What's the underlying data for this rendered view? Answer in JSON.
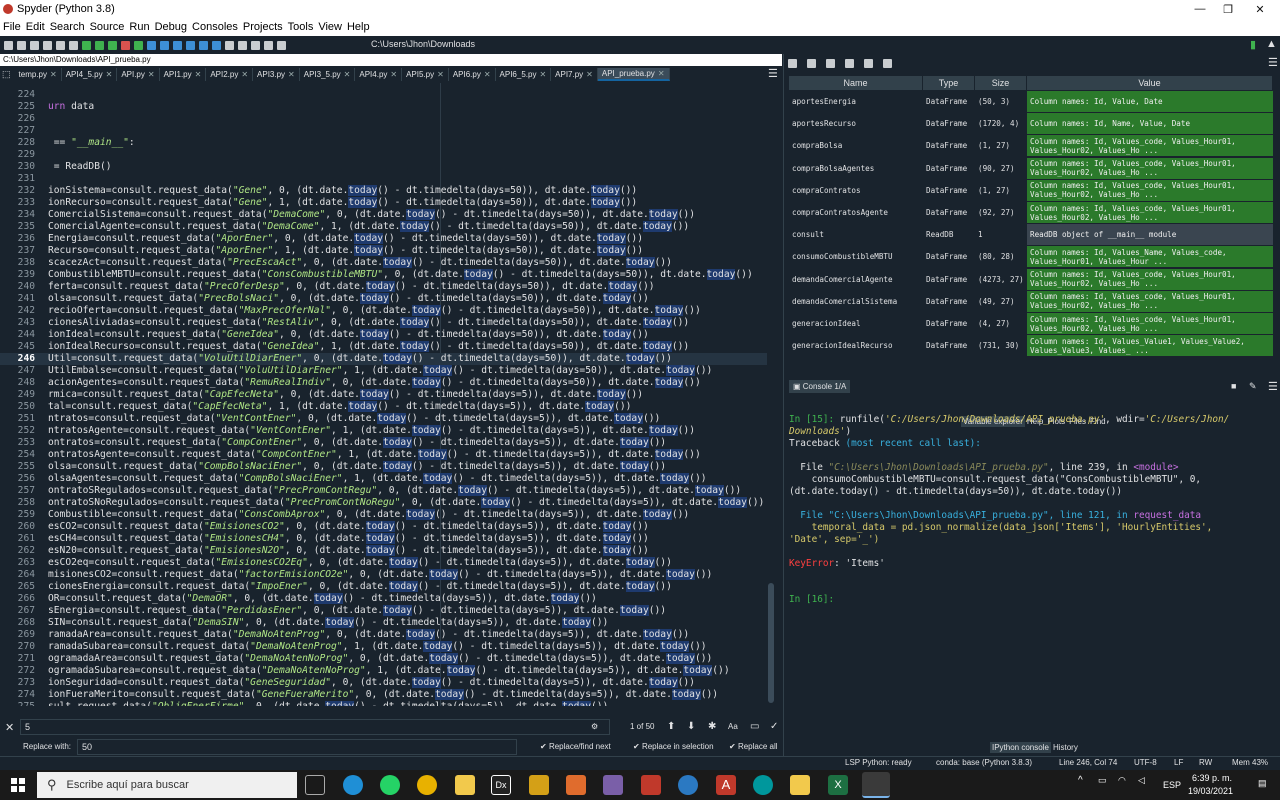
{
  "window": {
    "title": "Spyder (Python 3.8)",
    "minimize": "—",
    "restore": "❐",
    "close": "✕"
  },
  "menu": [
    "File",
    "Edit",
    "Search",
    "Source",
    "Run",
    "Debug",
    "Consoles",
    "Projects",
    "Tools",
    "View",
    "Help"
  ],
  "toolbar": {
    "path": "C:\\Users\\Jhon\\Downloads"
  },
  "editor": {
    "filepath": "C:\\Users\\Jhon\\Downloads\\API_prueba.py",
    "tabs": [
      "temp.py",
      "API4_5.py",
      "API.py",
      "API1.py",
      "API2.py",
      "API3.py",
      "API3_5.py",
      "API4.py",
      "API5.py",
      "API6.py",
      "API6_5.py",
      "API7.py",
      "API_prueba.py"
    ],
    "active_tab": "API_prueba.py",
    "current_line": 246,
    "lines": [
      {
        "n": "224",
        "t": ""
      },
      {
        "n": "225",
        "t": "urn data"
      },
      {
        "n": "226",
        "t": ""
      },
      {
        "n": "227",
        "t": ""
      },
      {
        "n": "228",
        "t": " == \"__main__\":"
      },
      {
        "n": "229",
        "t": ""
      },
      {
        "n": "230",
        "t": " = ReadDB()"
      },
      {
        "n": "231",
        "t": ""
      },
      {
        "n": "232",
        "t": "ionSistema=consult.request_data(\"Gene\", 0, (dt.date.today() - dt.timedelta(days=50)), dt.date.today())"
      },
      {
        "n": "233",
        "t": "ionRecurso=consult.request_data(\"Gene\", 1, (dt.date.today() - dt.timedelta(days=50)), dt.date.today())"
      },
      {
        "n": "234",
        "t": "ComercialSistema=consult.request_data(\"DemaCome\", 0, (dt.date.today() - dt.timedelta(days=50)), dt.date.today())"
      },
      {
        "n": "235",
        "t": "ComercialAgente=consult.request_data(\"DemaCome\", 1, (dt.date.today() - dt.timedelta(days=50)), dt.date.today())"
      },
      {
        "n": "236",
        "t": "Energia=consult.request_data(\"AporEner\", 0, (dt.date.today() - dt.timedelta(days=50)), dt.date.today())"
      },
      {
        "n": "237",
        "t": "Recurso=consult.request_data(\"AporEner\", 1, (dt.date.today() - dt.timedelta(days=50)), dt.date.today())"
      },
      {
        "n": "238",
        "t": "scacezAct=consult.request_data(\"PrecEscaAct\", 0, (dt.date.today() - dt.timedelta(days=50)), dt.date.today())"
      },
      {
        "n": "239",
        "t": "CombustibleMBTU=consult.request_data(\"ConsCombustibleMBTU\", 0, (dt.date.today() - dt.timedelta(days=50)), dt.date.today())"
      },
      {
        "n": "240",
        "t": "ferta=consult.request_data(\"PrecOferDesp\", 0, (dt.date.today() - dt.timedelta(days=50)), dt.date.today())"
      },
      {
        "n": "241",
        "t": "olsa=consult.request_data(\"PrecBolsNaci\", 0, (dt.date.today() - dt.timedelta(days=50)), dt.date.today())"
      },
      {
        "n": "242",
        "t": "recioOferta=consult.request_data(\"MaxPrecOferNal\", 0, (dt.date.today() - dt.timedelta(days=50)), dt.date.today())"
      },
      {
        "n": "243",
        "t": "cionesAliviadas=consult.request_data(\"RestAliv\", 0, (dt.date.today() - dt.timedelta(days=50)), dt.date.today())"
      },
      {
        "n": "244",
        "t": "ionIdeal=consult.request_data(\"GeneIdea\", 0, (dt.date.today() - dt.timedelta(days=50)), dt.date.today())"
      },
      {
        "n": "245",
        "t": "ionIdealRecurso=consult.request_data(\"GeneIdea\", 1, (dt.date.today() - dt.timedelta(days=50)), dt.date.today())"
      },
      {
        "n": "246",
        "t": "Util=consult.request_data(\"VoluUtilDiarEner\", 0, (dt.date.today() - dt.timedelta(days=50)), dt.date.today())"
      },
      {
        "n": "247",
        "t": "UtilEmbalse=consult.request_data(\"VoluUtilDiarEner\", 1, (dt.date.today() - dt.timedelta(days=50)), dt.date.today())"
      },
      {
        "n": "248",
        "t": "acionAgentes=consult.request_data(\"RemuRealIndiv\", 0, (dt.date.today() - dt.timedelta(days=50)), dt.date.today())"
      },
      {
        "n": "249",
        "t": "rmica=consult.request_data(\"CapEfecNeta\", 0, (dt.date.today() - dt.timedelta(days=5)), dt.date.today())"
      },
      {
        "n": "250",
        "t": "tal=consult.request_data(\"CapEfecNeta\", 1, (dt.date.today() - dt.timedelta(days=5)), dt.date.today())"
      },
      {
        "n": "251",
        "t": "ntratos=consult.request_data(\"VentContEner\", 0, (dt.date.today() - dt.timedelta(days=5)), dt.date.today())"
      },
      {
        "n": "252",
        "t": "ntratosAgente=consult.request_data(\"VentContEner\", 1, (dt.date.today() - dt.timedelta(days=5)), dt.date.today())"
      },
      {
        "n": "253",
        "t": "ontratos=consult.request_data(\"CompContEner\", 0, (dt.date.today() - dt.timedelta(days=5)), dt.date.today())"
      },
      {
        "n": "254",
        "t": "ontratosAgente=consult.request_data(\"CompContEner\", 1, (dt.date.today() - dt.timedelta(days=5)), dt.date.today())"
      },
      {
        "n": "255",
        "t": "olsa=consult.request_data(\"CompBolsNaciEner\", 0, (dt.date.today() - dt.timedelta(days=5)), dt.date.today())"
      },
      {
        "n": "256",
        "t": "olsaAgentes=consult.request_data(\"CompBolsNaciEner\", 1, (dt.date.today() - dt.timedelta(days=5)), dt.date.today())"
      },
      {
        "n": "257",
        "t": "ontratoSRegulados=consult.request_data(\"PrecPromContRegu\", 0, (dt.date.today() - dt.timedelta(days=5)), dt.date.today())"
      },
      {
        "n": "258",
        "t": "ontratoSNoRegulados=consult.request_data(\"PrecPromContNoRegu\", 0, (dt.date.today() - dt.timedelta(days=5)), dt.date.today())"
      },
      {
        "n": "259",
        "t": "Combustible=consult.request_data(\"ConsCombAprox\", 0, (dt.date.today() - dt.timedelta(days=5)), dt.date.today())"
      },
      {
        "n": "260",
        "t": "esCO2=consult.request_data(\"EmisionesCO2\", 0, (dt.date.today() - dt.timedelta(days=5)), dt.date.today())"
      },
      {
        "n": "261",
        "t": "esCH4=consult.request_data(\"EmisionesCH4\", 0, (dt.date.today() - dt.timedelta(days=5)), dt.date.today())"
      },
      {
        "n": "262",
        "t": "esN20=consult.request_data(\"EmisionesN2O\", 0, (dt.date.today() - dt.timedelta(days=5)), dt.date.today())"
      },
      {
        "n": "263",
        "t": "esCO2eq=consult.request_data(\"EmisionesCO2Eq\", 0, (dt.date.today() - dt.timedelta(days=5)), dt.date.today())"
      },
      {
        "n": "264",
        "t": "misionesCO2=consult.request_data(\"factorEmisionCO2e\", 0, (dt.date.today() - dt.timedelta(days=5)), dt.date.today())"
      },
      {
        "n": "265",
        "t": "cionesEnergia=consult.request_data(\"ImpoEner\", 0, (dt.date.today() - dt.timedelta(days=5)), dt.date.today())"
      },
      {
        "n": "266",
        "t": "OR=consult.request_data(\"DemaOR\", 0, (dt.date.today() - dt.timedelta(days=5)), dt.date.today())"
      },
      {
        "n": "267",
        "t": "sEnergia=consult.request_data(\"PerdidasEner\", 0, (dt.date.today() - dt.timedelta(days=5)), dt.date.today())"
      },
      {
        "n": "268",
        "t": "SIN=consult.request_data(\"DemaSIN\", 0, (dt.date.today() - dt.timedelta(days=5)), dt.date.today())"
      },
      {
        "n": "269",
        "t": "ramadaArea=consult.request_data(\"DemaNoAtenProg\", 0, (dt.date.today() - dt.timedelta(days=5)), dt.date.today())"
      },
      {
        "n": "270",
        "t": "ramadaSubarea=consult.request_data(\"DemaNoAtenProg\", 1, (dt.date.today() - dt.timedelta(days=5)), dt.date.today())"
      },
      {
        "n": "271",
        "t": "ogramadaArea=consult.request_data(\"DemaNoAtenNoProg\", 0, (dt.date.today() - dt.timedelta(days=5)), dt.date.today())"
      },
      {
        "n": "272",
        "t": "ogramadaSubarea=consult.request_data(\"DemaNoAtenNoProg\", 1, (dt.date.today() - dt.timedelta(days=5)), dt.date.today())"
      },
      {
        "n": "273",
        "t": "ionSeguridad=consult.request_data(\"GeneSeguridad\", 0, (dt.date.today() - dt.timedelta(days=5)), dt.date.today())"
      },
      {
        "n": "274",
        "t": "ionFueraMerito=consult.request_data(\"GeneFueraMerito\", 0, (dt.date.today() - dt.timedelta(days=5)), dt.date.today())"
      },
      {
        "n": "275",
        "t": "sult.request_data(\"ObligEnerFirme\", 0, (dt.date.today() - dt.timedelta(days=5)), dt.date.today())"
      }
    ]
  },
  "find": {
    "search_value": "5",
    "counter": "1 of 50",
    "replace_label": "Replace with:",
    "replace_value": "50",
    "replace_find_next": "Replace/find next",
    "replace_in_selection": "Replace in selection",
    "replace_all": "Replace all",
    "case_label": "Aa"
  },
  "variable_explorer": {
    "headers": [
      "Name",
      "Type",
      "Size",
      "Value"
    ],
    "rows": [
      {
        "name": "aportesEnergia",
        "type": "DataFrame",
        "size": "(50, 3)",
        "value": "Column names: Id, Value, Date"
      },
      {
        "name": "aportesRecurso",
        "type": "DataFrame",
        "size": "(1720, 4)",
        "value": "Column names: Id, Name, Value, Date"
      },
      {
        "name": "compraBolsa",
        "type": "DataFrame",
        "size": "(1, 27)",
        "value": "Column names: Id, Values_code, Values_Hour01,\nValues_Hour02, Values_Ho ..."
      },
      {
        "name": "compraBolsaAgentes",
        "type": "DataFrame",
        "size": "(90, 27)",
        "value": "Column names: Id, Values_code, Values_Hour01,\nValues_Hour02, Values_Ho ..."
      },
      {
        "name": "compraContratos",
        "type": "DataFrame",
        "size": "(1, 27)",
        "value": "Column names: Id, Values_code, Values_Hour01,\nValues_Hour02, Values_Ho ..."
      },
      {
        "name": "compraContratosAgente",
        "type": "DataFrame",
        "size": "(92, 27)",
        "value": "Column names: Id, Values_code, Values_Hour01,\nValues_Hour02, Values_Ho ..."
      },
      {
        "name": "consult",
        "type": "ReadDB",
        "size": "1",
        "value": "ReadDB object of __main__ module"
      },
      {
        "name": "consumoCombustibleMBTU",
        "type": "DataFrame",
        "size": "(80, 28)",
        "value": "Column names: Id, Values_Name, Values_code,\nValues_Hour01, Values_Hour ..."
      },
      {
        "name": "demandaComercialAgente",
        "type": "DataFrame",
        "size": "(4273, 27)",
        "value": "Column names: Id, Values_code, Values_Hour01,\nValues_Hour02, Values_Ho ..."
      },
      {
        "name": "demandaComercialSistema",
        "type": "DataFrame",
        "size": "(49, 27)",
        "value": "Column names: Id, Values_code, Values_Hour01,\nValues_Hour02, Values_Ho ..."
      },
      {
        "name": "generacionIdeal",
        "type": "DataFrame",
        "size": "(4, 27)",
        "value": "Column names: Id, Values_code, Values_Hour01,\nValues_Hour02, Values_Ho ..."
      },
      {
        "name": "generacionIdealRecurso",
        "type": "DataFrame",
        "size": "(731, 30)",
        "value": "Column names: Id, Values_Value1, Values_Value2,\nValues_Value3, Values_ ..."
      }
    ],
    "tabs": [
      "Variable explorer",
      "Help",
      "Plots",
      "Files",
      "Find"
    ]
  },
  "console": {
    "tab": "Console 1/A",
    "prompt15": "In [15]:",
    "runfile": " runfile(",
    "runfile_path": "'C:/Users/Jhon/Downloads/API_prueba.py'",
    "wdir_label": ", wdir=",
    "wdir_path": "'C:/Users/Jhon/",
    "wdir_path2": "Downloads'",
    "close_paren": ")",
    "traceback": "Traceback ",
    "traceback_tail": "(most recent call last):",
    "file1_label": "  File ",
    "file1_path": "\"C:\\Users\\Jhon\\Downloads\\API_prueba.py\"",
    "file1_line": ", line 239, in ",
    "file1_module": "<module>",
    "code1a": "    consumoCombustibleMBTU=consult.request_data(\"ConsCombustibleMBTU\", 0,",
    "code1b": "(dt.date.today() - dt.timedelta(days=50)), dt.date.today())",
    "file2_label": "  File ",
    "file2_path": "\"C:\\Users\\Jhon\\Downloads\\API_prueba.py\"",
    "file2_line": ", line 121, in ",
    "file2_func": "request_data",
    "code2a": "    temporal_data = pd.json_normalize(data_json['Items'], 'HourlyEntities',",
    "code2b": "'Date', sep='_')",
    "error_type": "KeyError",
    "error_msg": ": 'Items'",
    "prompt16": "In [16]:",
    "tabs": [
      "IPython console",
      "History"
    ]
  },
  "status": {
    "lsp": "LSP Python: ready",
    "conda": "conda: base (Python 3.8.3)",
    "pos": "Line 246, Col 74",
    "enc": "UTF-8",
    "eol": "LF",
    "rw": "RW",
    "mem": "Mem 43%"
  },
  "taskbar": {
    "search_placeholder": "Escribe aquí para buscar",
    "lang": "ESP",
    "time": "6:39 p. m.",
    "date": "19/03/2021"
  }
}
